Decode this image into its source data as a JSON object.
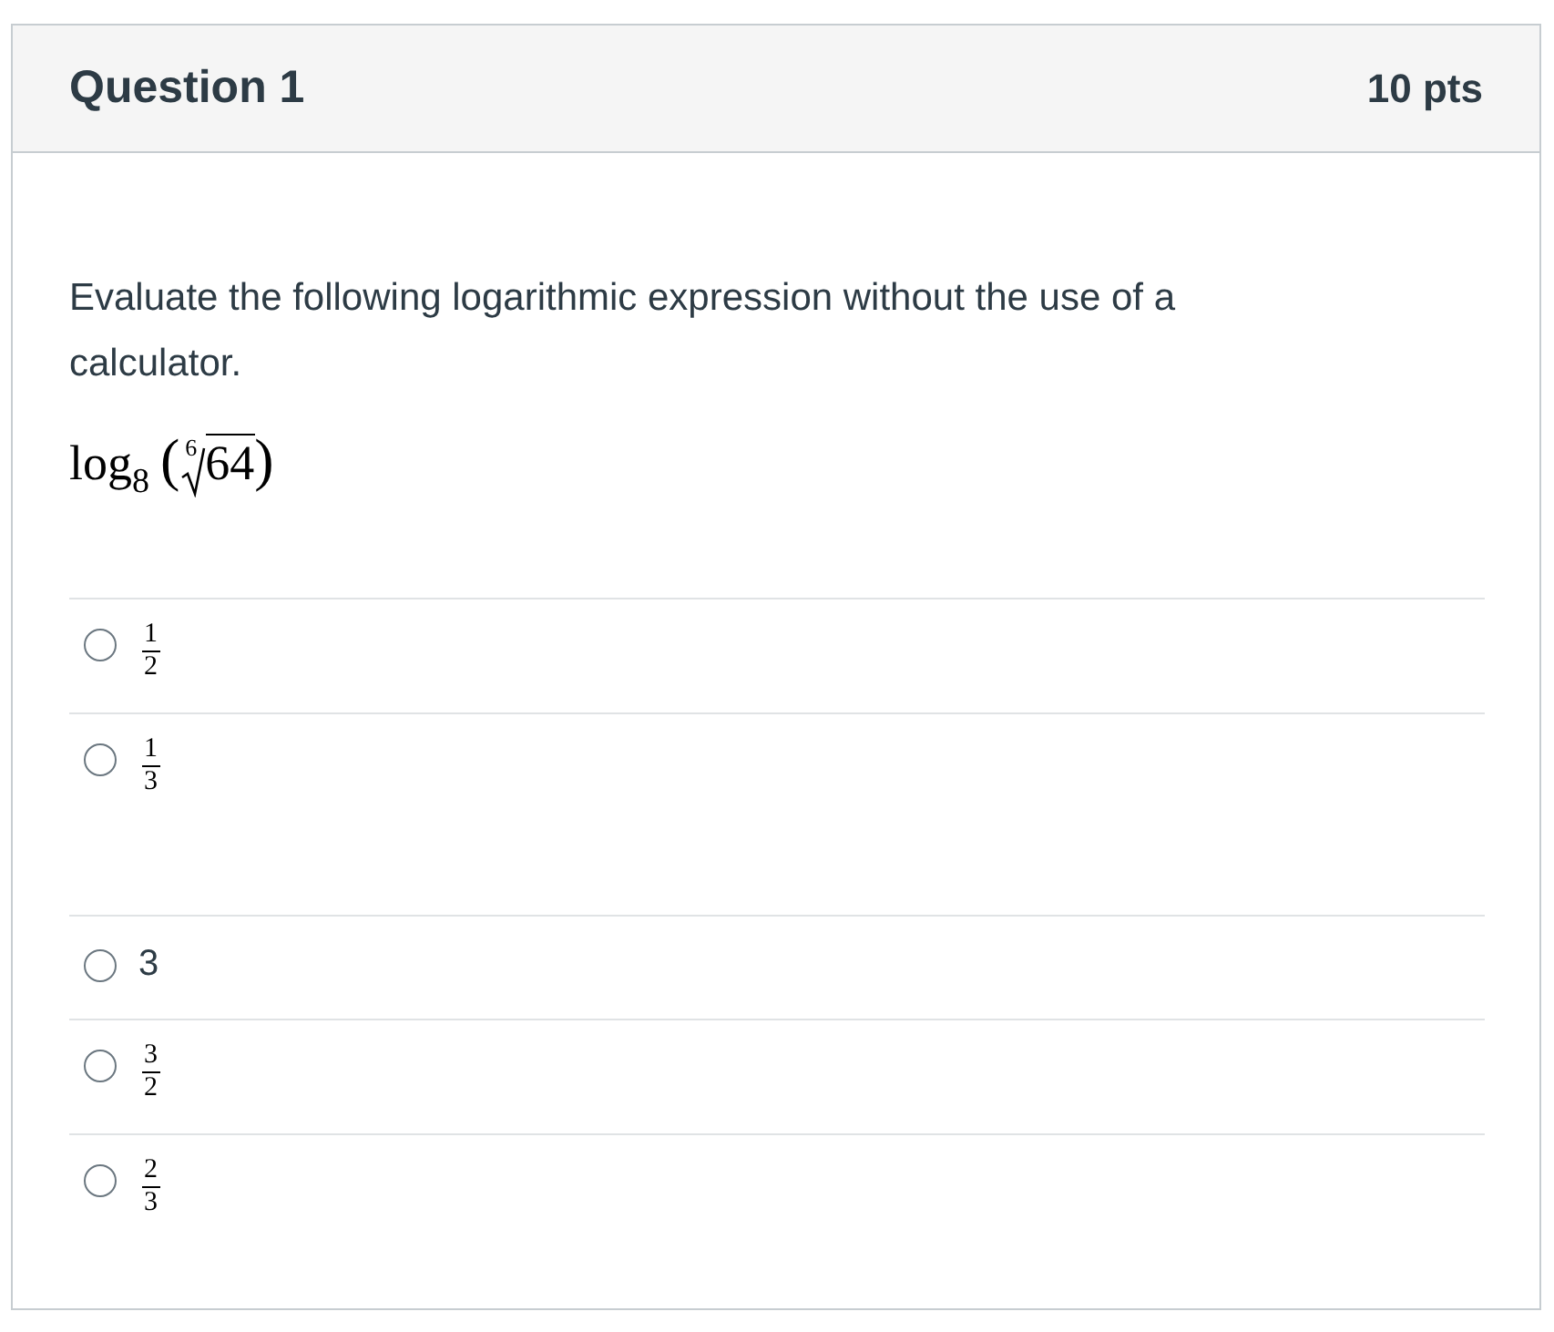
{
  "question": {
    "title": "Question 1",
    "points": "10 pts",
    "prompt": "Evaluate the following logarithmic expression without the use of a calculator.",
    "expression": {
      "function": "log",
      "base": "8",
      "open": "(",
      "root_index": "6",
      "radicand": "64",
      "close": ")"
    }
  },
  "answers": [
    {
      "kind": "fraction",
      "numerator": "1",
      "denominator": "2",
      "selected": false
    },
    {
      "kind": "fraction",
      "numerator": "1",
      "denominator": "3",
      "selected": false
    },
    {
      "kind": "text",
      "text": "3",
      "selected": false
    },
    {
      "kind": "fraction",
      "numerator": "3",
      "denominator": "2",
      "selected": false
    },
    {
      "kind": "fraction",
      "numerator": "2",
      "denominator": "3",
      "selected": false
    }
  ]
}
